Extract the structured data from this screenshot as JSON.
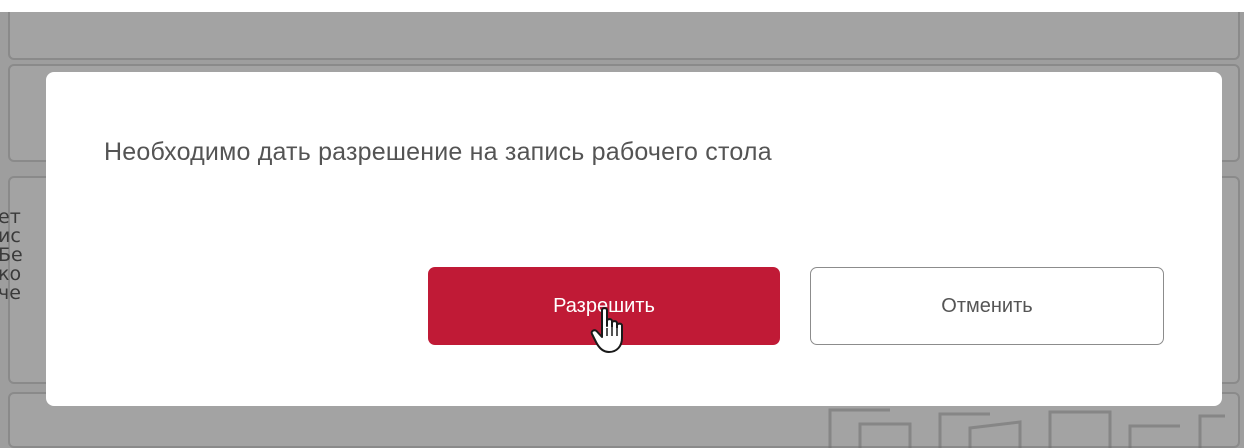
{
  "dialog": {
    "message": "Необходимо дать разрешение на запись рабочего стола",
    "allow_label": "Разрешить",
    "cancel_label": "Отменить"
  },
  "background": {
    "text_lines": [
      "ет",
      "ис",
      "Бе",
      "ко",
      "че"
    ]
  },
  "colors": {
    "overlay": "#9e9e9e",
    "primary_button": "#c01a36",
    "secondary_border": "#8c8c8c",
    "message_text": "#545454"
  },
  "icons": {
    "cursor": "hand-pointer-icon"
  }
}
